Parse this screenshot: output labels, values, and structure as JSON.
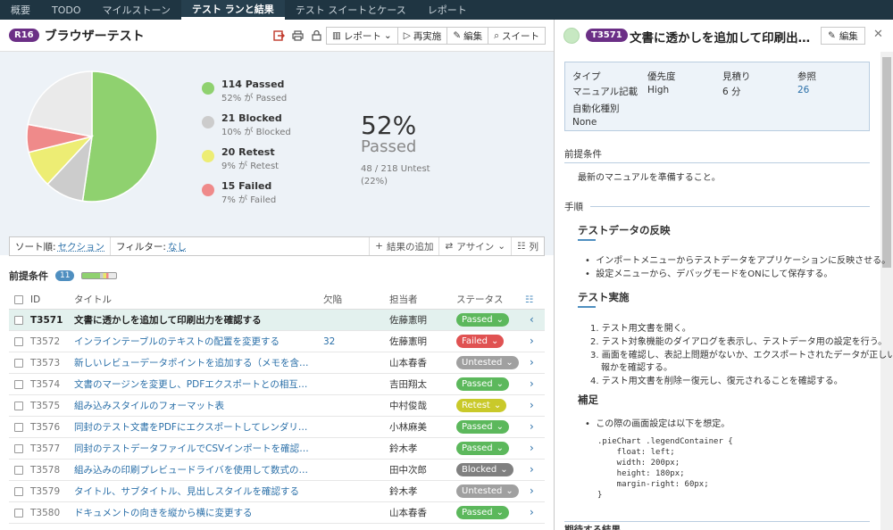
{
  "nav": {
    "tabs": [
      "概要",
      "TODO",
      "マイルストーン",
      "テスト ランと結果",
      "テスト スイートとケース",
      "レポート"
    ]
  },
  "run": {
    "id": "R16",
    "title": "ブラウザーテスト"
  },
  "toolbar": {
    "report": "レポート",
    "rerun": "再実施",
    "edit": "編集",
    "suite": "スイート"
  },
  "summary": {
    "legend": [
      {
        "label": "114 Passed",
        "sub": "52% が Passed",
        "color": "#8fd16f",
        "count": 114
      },
      {
        "label": "21 Blocked",
        "sub": "10% が Blocked",
        "color": "#cccccc",
        "count": 21
      },
      {
        "label": "20 Retest",
        "sub": "9% が Retest",
        "color": "#eded74",
        "count": 20
      },
      {
        "label": "15 Failed",
        "sub": "7% が Failed",
        "color": "#ef8a8a",
        "count": 15
      }
    ],
    "untested_count": 48,
    "pct": "52%",
    "pct_word": "Passed",
    "untest_line1": "48 / 218 Untest",
    "untest_line2": "(22%)"
  },
  "filter": {
    "sort_label": "ソート順:",
    "sort_value": "セクション",
    "filter_label": "フィルター:",
    "filter_value": "なし",
    "add_result": "結果の追加",
    "assign": "アサイン",
    "columns": "列"
  },
  "section": {
    "name": "前提条件",
    "count": "11"
  },
  "table": {
    "headers": {
      "id": "ID",
      "title": "タイトル",
      "defect": "欠陥",
      "assignee": "担当者",
      "status": "ステータス"
    },
    "rows": [
      {
        "id": "T3571",
        "title": "文書に透かしを追加して印刷出力を確認する",
        "defect": "",
        "assignee": "佐藤憲明",
        "status": "Passed",
        "color": "#5cb85c",
        "selected": true
      },
      {
        "id": "T3572",
        "title": "インラインテーブルのテキストの配置を変更する",
        "defect": "32",
        "assignee": "佐藤憲明",
        "status": "Failed",
        "color": "#e05252"
      },
      {
        "id": "T3573",
        "title": "新しいレビューデータポイントを追加する（メモを含む）",
        "defect": "",
        "assignee": "山本春香",
        "status": "Untested",
        "color": "#a0a0a0"
      },
      {
        "id": "T3574",
        "title": "文書のマージンを変更し、PDFエクスポートとの相互運用性をテ...",
        "defect": "",
        "assignee": "吉田翔太",
        "status": "Passed",
        "color": "#5cb85c"
      },
      {
        "id": "T3575",
        "title": "組み込みスタイルのフォーマット表",
        "defect": "",
        "assignee": "中村俊哉",
        "status": "Retest",
        "color": "#c9c92a"
      },
      {
        "id": "T3576",
        "title": "同封のテスト文書をPDFにエクスポートしてレンダリングを確認する",
        "defect": "",
        "assignee": "小林麻美",
        "status": "Passed",
        "color": "#5cb85c"
      },
      {
        "id": "T3577",
        "title": "同封のテストデータファイルでCSVインポートを確認する",
        "defect": "",
        "assignee": "鈴木孝",
        "status": "Passed",
        "color": "#5cb85c"
      },
      {
        "id": "T3578",
        "title": "組み込みの印刷プレビュードライバを使用して数式のレンダリング...",
        "defect": "",
        "assignee": "田中次郎",
        "status": "Blocked",
        "color": "#808080"
      },
      {
        "id": "T3579",
        "title": "タイトル、サブタイトル、見出しスタイルを確認する",
        "defect": "",
        "assignee": "鈴木孝",
        "status": "Untested",
        "color": "#a0a0a0"
      },
      {
        "id": "T3580",
        "title": "ドキュメントの向きを縦から横に変更する",
        "defect": "",
        "assignee": "山本春香",
        "status": "Passed",
        "color": "#5cb85c"
      }
    ]
  },
  "detail": {
    "id": "T3571",
    "title": "文書に透かしを追加して印刷出力...",
    "edit": "編集",
    "meta": {
      "type_k": "タイプ",
      "type_v": "マニュアル記載",
      "priority_k": "優先度",
      "priority_v": "High",
      "estimate_k": "見積り",
      "estimate_v": "6 分",
      "ref_k": "参照",
      "ref_v": "26",
      "auto_k": "自動化種別",
      "auto_v": "None"
    },
    "precond_h": "前提条件",
    "precond_t": "最新のマニュアルを準備すること。",
    "steps_h": "手順",
    "sub1": "テストデータの反映",
    "b1": "インポートメニューからテストデータをアプリケーションに反映させる。",
    "b2": "設定メニューから、デバッグモードをONにして保存する。",
    "sub2": "テスト実施",
    "s1": "テスト用文書を開く。",
    "s2": "テスト対象機能のダイアログを表示し、テストデータ用の設定を行う。",
    "s3a": "画面を確認し、表記上問題がないか、エクスポートされたデータが正しい情",
    "s3b": "報かを確認する。",
    "s4": "テスト用文書を削除ー復元し、復元されることを確認する。",
    "sub3": "補足",
    "b3": "この際の画面設定は以下を想定。",
    "code": ".pieChart .legendContainer {\n    float: left;\n    width: 200px;\n    height: 180px;\n    margin-right: 60px;\n}",
    "expected_h": "期待する結果"
  }
}
